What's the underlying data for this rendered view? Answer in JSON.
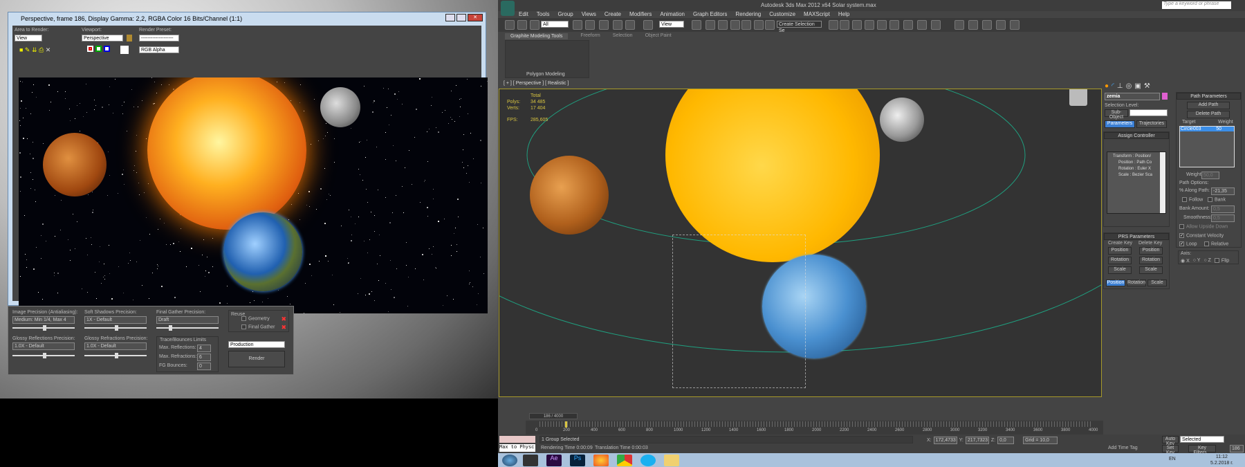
{
  "render_window": {
    "title": "Perspective, frame 186, Display Gamma: 2,2, RGBA Color 16 Bits/Channel (1:1)",
    "area_to_render_label": "Area to Render:",
    "area_to_render_value": "View",
    "viewport_label": "Viewport:",
    "viewport_value": "Perspective",
    "render_preset_label": "Render Preset:",
    "render_preset_value": "--------------------",
    "channel_value": "RGB Alpha"
  },
  "render_settings": {
    "image_precision_label": "Image Precision (Antialiasing):",
    "image_precision_value": "Medium: Min 1/4, Max 4",
    "soft_shadows_label": "Soft Shadows Precision:",
    "soft_shadows_value": "1X - Default",
    "final_gather_label": "Final Gather Precision:",
    "final_gather_value": "Draft",
    "glossy_refl_label": "Glossy Reflections Precision:",
    "glossy_refl_value": "1.0X - Default",
    "glossy_refr_label": "Glossy Refractions Precision:",
    "glossy_refr_value": "1.0X - Default",
    "reuse_label": "Reuse",
    "geometry_label": "Geometry",
    "final_gather_reuse_label": "Final Gather",
    "trace_label": "Trace/Bounces Limits",
    "max_reflections_label": "Max. Reflections:",
    "max_reflections": "4",
    "max_refractions_label": "Max. Refractions:",
    "max_refractions": "6",
    "fg_bounces_label": "FG Bounces:",
    "fg_bounces": "0",
    "mode_value": "Production",
    "render_button": "Render"
  },
  "max": {
    "title": "Autodesk 3ds Max  2012 x64     Solar system.max",
    "search_placeholder": "Type a keyword or phrase",
    "menu": [
      "Edit",
      "Tools",
      "Group",
      "Views",
      "Create",
      "Modifiers",
      "Animation",
      "Graph Editors",
      "Rendering",
      "Customize",
      "MAXScript",
      "Help"
    ],
    "selection_filter": "All",
    "ref_coord": "View",
    "selection_set": "Create Selection Se",
    "ribbon_tabs": [
      "Graphite Modeling Tools",
      "Freeform",
      "Selection",
      "Object Paint"
    ],
    "ribbon_panel": "Polygon Modeling",
    "viewport_label": "[ + ] [ Perspective ] [ Realistic ]",
    "stats": {
      "total_label": "Total",
      "polys_label": "Polys:",
      "polys": "34 485",
      "verts_label": "Verts:",
      "verts": "17 404",
      "fps_label": "FPS:",
      "fps": "285,605"
    }
  },
  "command_panel": {
    "object_name": "zemia",
    "object_color": "#e060d0",
    "selection_level_label": "Selection Level:",
    "sub_object_label": "Sub-Object",
    "tabs": [
      "Parameters",
      "Trajectories"
    ],
    "assign_controller_title": "Assign Controller",
    "tree": [
      "Transform : Position/",
      "Position : Path Co",
      "Rotation : Euler X",
      "Scale : Bezier Sca"
    ],
    "prs_title": "PRS Parameters",
    "create_key_label": "Create Key",
    "delete_key_label": "Delete Key",
    "key_buttons": [
      "Position",
      "Rotation",
      "Scale"
    ],
    "bottom_tabs": [
      "Position",
      "Rotation",
      "Scale"
    ]
  },
  "path_params": {
    "title": "Path Parameters",
    "add_path": "Add Path",
    "delete_path": "Delete Path",
    "target_header": "Target",
    "weight_header": "Weight",
    "targets": [
      {
        "name": "Circle003",
        "weight": "50"
      }
    ],
    "weight_label": "Weight:",
    "weight_value": "50,0",
    "path_options_label": "Path Options:",
    "along_path_label": "% Along Path:",
    "along_path_value": "-21,35",
    "follow_label": "Follow",
    "bank_label": "Bank",
    "bank_amount_label": "Bank Amount:",
    "bank_amount": "0,5",
    "smoothness_label": "Smoothness:",
    "smoothness": "0,5",
    "allow_upside_label": "Allow Upside Down",
    "constant_velocity_label": "Constant Velocity",
    "loop_label": "Loop",
    "relative_label": "Relative",
    "axis_label": "Axis:",
    "axis_options": [
      "X",
      "Y",
      "Z"
    ],
    "flip_label": "Flip"
  },
  "timeline": {
    "frame": "186 / 4000",
    "current_frame": 186,
    "total_frames": 4000,
    "ticks": [
      "0",
      "200",
      "400",
      "600",
      "800",
      "1000",
      "1200",
      "1400",
      "1600",
      "1800",
      "2000",
      "2200",
      "2400",
      "2600",
      "2800",
      "3000",
      "3200",
      "3400",
      "3600",
      "3800",
      "4000"
    ]
  },
  "status": {
    "selection": "1 Group Selected",
    "x_label": "X:",
    "x": "172,4733",
    "y_label": "Y:",
    "y": "217,7323",
    "z_label": "Z:",
    "z": "0,0",
    "grid": "Grid = 10,0",
    "rendering_time": "Rendering Time  0:00:09",
    "translation_time": "Translation Time  0:00:03",
    "add_time_tag": "Add Time Tag",
    "auto_key": "Auto Key",
    "set_key": "Set Key",
    "key_mode": "Selected",
    "key_filters": "Key Filters...",
    "frame_field": "186",
    "maxscript": "Max to Physc"
  },
  "taskbar": {
    "lang": "EN",
    "time": "11:12",
    "date": "5.2.2018 г."
  }
}
